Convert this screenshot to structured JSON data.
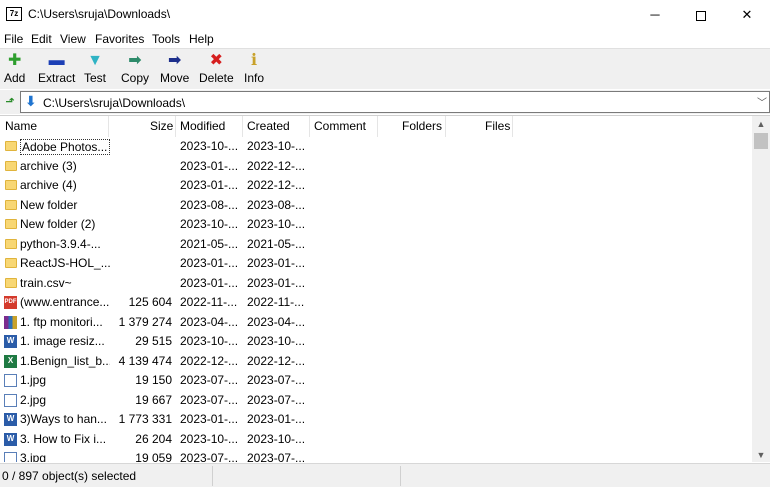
{
  "window": {
    "title": "C:\\Users\\sruja\\Downloads\\",
    "app_icon_text": "7z"
  },
  "menu": [
    "File",
    "Edit",
    "View",
    "Favorites",
    "Tools",
    "Help"
  ],
  "toolbar": [
    {
      "label": "Add",
      "icon": "plus-icon",
      "glyph": "✚",
      "color": "#2e9e2e"
    },
    {
      "label": "Extract",
      "icon": "minus-icon",
      "glyph": "▬",
      "color": "#1c3fb5"
    },
    {
      "label": "Test",
      "icon": "check-arrow-icon",
      "glyph": "▼",
      "color": "#2fb3c4"
    },
    {
      "label": "Copy",
      "icon": "copy-arrow-icon",
      "glyph": "➡",
      "color": "#2e8b6b"
    },
    {
      "label": "Move",
      "icon": "move-arrow-icon",
      "glyph": "➡",
      "color": "#1c2f8c"
    },
    {
      "label": "Delete",
      "icon": "delete-x-icon",
      "glyph": "✖",
      "color": "#d61f1f"
    },
    {
      "label": "Info",
      "icon": "info-icon",
      "glyph": "ℹ",
      "color": "#c8a12a"
    }
  ],
  "address": {
    "path": "C:\\Users\\sruja\\Downloads\\"
  },
  "columns": [
    "Name",
    "Size",
    "Modified",
    "Created",
    "Comment",
    "Folders",
    "Files"
  ],
  "files": [
    {
      "name": "Adobe Photos...",
      "size": "",
      "modified": "2023-10-...",
      "created": "2023-10-...",
      "type": "folder"
    },
    {
      "name": "archive (3)",
      "size": "",
      "modified": "2023-01-...",
      "created": "2022-12-...",
      "type": "folder"
    },
    {
      "name": "archive (4)",
      "size": "",
      "modified": "2023-01-...",
      "created": "2022-12-...",
      "type": "folder"
    },
    {
      "name": "New folder",
      "size": "",
      "modified": "2023-08-...",
      "created": "2023-08-...",
      "type": "folder"
    },
    {
      "name": "New folder (2)",
      "size": "",
      "modified": "2023-10-...",
      "created": "2023-10-...",
      "type": "folder"
    },
    {
      "name": "python-3.9.4-...",
      "size": "",
      "modified": "2021-05-...",
      "created": "2021-05-...",
      "type": "folder"
    },
    {
      "name": "ReactJS-HOL_...",
      "size": "",
      "modified": "2023-01-...",
      "created": "2023-01-...",
      "type": "folder"
    },
    {
      "name": "train.csv~",
      "size": "",
      "modified": "2023-01-...",
      "created": "2023-01-...",
      "type": "folder"
    },
    {
      "name": "(www.entrance...",
      "size": "125 604",
      "modified": "2022-11-...",
      "created": "2022-11-...",
      "type": "pdf"
    },
    {
      "name": "1. ftp monitori...",
      "size": "1 379 274",
      "modified": "2023-04-...",
      "created": "2023-04-...",
      "type": "rar"
    },
    {
      "name": "1. image resiz...",
      "size": "29 515",
      "modified": "2023-10-...",
      "created": "2023-10-...",
      "type": "word"
    },
    {
      "name": "1.Benign_list_b...",
      "size": "4 139 474",
      "modified": "2022-12-...",
      "created": "2022-12-...",
      "type": "excel"
    },
    {
      "name": "1.jpg",
      "size": "19 150",
      "modified": "2023-07-...",
      "created": "2023-07-...",
      "type": "image"
    },
    {
      "name": "2.jpg",
      "size": "19 667",
      "modified": "2023-07-...",
      "created": "2023-07-...",
      "type": "image"
    },
    {
      "name": "3)Ways to han...",
      "size": "1 773 331",
      "modified": "2023-01-...",
      "created": "2023-01-...",
      "type": "word"
    },
    {
      "name": "3. How to Fix i...",
      "size": "26 204",
      "modified": "2023-10-...",
      "created": "2023-10-...",
      "type": "word"
    },
    {
      "name": "3.jpg",
      "size": "19 059",
      "modified": "2023-07-...",
      "created": "2023-07-...",
      "type": "image"
    }
  ],
  "status": {
    "selection": "0 / 897 object(s) selected"
  }
}
